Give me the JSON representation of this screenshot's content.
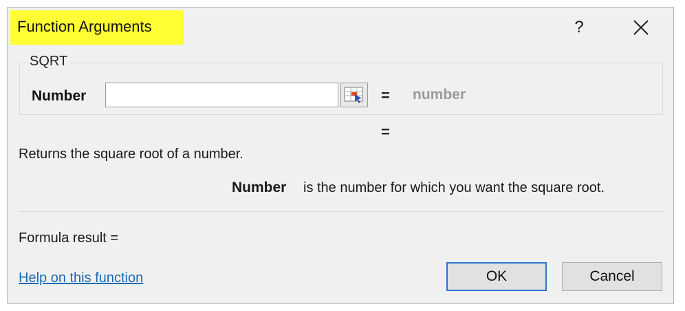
{
  "window": {
    "title": "Function Arguments",
    "help_label": "?",
    "title_highlight_color": "#ffff33"
  },
  "function": {
    "name": "SQRT",
    "argument": {
      "label": "Number",
      "value": "",
      "equals": "=",
      "result_placeholder": "number"
    },
    "overall_equals": "=",
    "description": "Returns the square root of a number.",
    "argument_help": {
      "name": "Number",
      "text": "is the number for which you want the square root."
    }
  },
  "footer": {
    "formula_result_label": "Formula result =",
    "help_link": "Help on this function",
    "ok_label": "OK",
    "cancel_label": "Cancel"
  },
  "icons": {
    "close": "close-icon",
    "collapse": "range-selector-icon"
  }
}
